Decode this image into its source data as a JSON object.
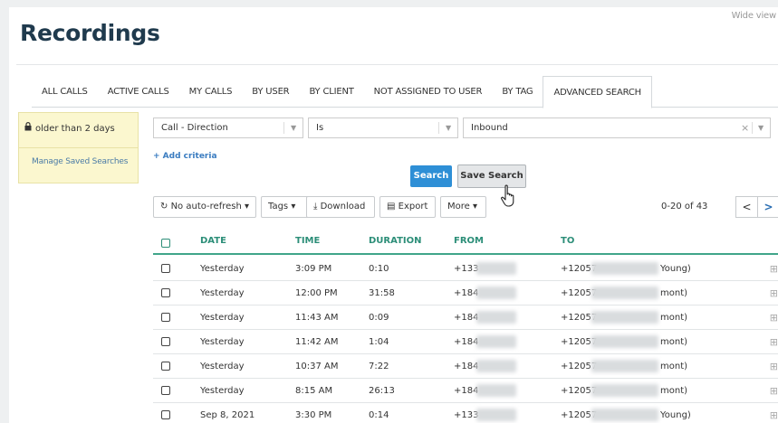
{
  "header": {
    "title": "Recordings",
    "wide_view": "Wide view"
  },
  "tabs": [
    {
      "label": "ALL CALLS"
    },
    {
      "label": "ACTIVE CALLS"
    },
    {
      "label": "MY CALLS"
    },
    {
      "label": "BY USER"
    },
    {
      "label": "BY CLIENT"
    },
    {
      "label": "NOT ASSIGNED TO USER"
    },
    {
      "label": "BY TAG"
    },
    {
      "label": "ADVANCED SEARCH"
    }
  ],
  "sidebar": {
    "saved_search": "older than 2 days",
    "manage_link": "Manage Saved Searches"
  },
  "criteria": {
    "field": "Call - Direction",
    "operator": "Is",
    "value": "Inbound",
    "add_label": "+ Add criteria"
  },
  "actions": {
    "search_label": "Search",
    "save_search_label": "Save Search"
  },
  "toolbar": {
    "refresh_label": "No auto-refresh",
    "tags_label": "Tags",
    "download_label": "Download",
    "export_label": "Export",
    "more_label": "More"
  },
  "pager": {
    "range": "0-20 of 43",
    "prev": "<",
    "next": ">"
  },
  "table": {
    "headers": {
      "date": "DATE",
      "time": "TIME",
      "duration": "DURATION",
      "from": "FROM",
      "to": "TO"
    },
    "rows": [
      {
        "date": "Yesterday",
        "time": "3:09 PM",
        "duration": "0:10",
        "from": "+133",
        "to": "+12057",
        "to_suffix": "Young)"
      },
      {
        "date": "Yesterday",
        "time": "12:00 PM",
        "duration": "31:58",
        "from": "+184",
        "to": "+12057",
        "to_suffix": "mont)"
      },
      {
        "date": "Yesterday",
        "time": "11:43 AM",
        "duration": "0:09",
        "from": "+184",
        "to": "+12057",
        "to_suffix": "mont)"
      },
      {
        "date": "Yesterday",
        "time": "11:42 AM",
        "duration": "1:04",
        "from": "+184",
        "to": "+12057",
        "to_suffix": "mont)"
      },
      {
        "date": "Yesterday",
        "time": "10:37 AM",
        "duration": "7:22",
        "from": "+184",
        "to": "+12057",
        "to_suffix": "mont)"
      },
      {
        "date": "Yesterday",
        "time": "8:15 AM",
        "duration": "26:13",
        "from": "+184",
        "to": "+12057",
        "to_suffix": "mont)"
      },
      {
        "date": "Sep 8, 2021",
        "time": "3:30 PM",
        "duration": "0:14",
        "from": "+133",
        "to": "+12057",
        "to_suffix": "Young)"
      }
    ]
  },
  "colors": {
    "accent_green": "#2c8e78",
    "primary_blue": "#2e8fd6",
    "sidebar_yellow": "#fbf7cf"
  }
}
